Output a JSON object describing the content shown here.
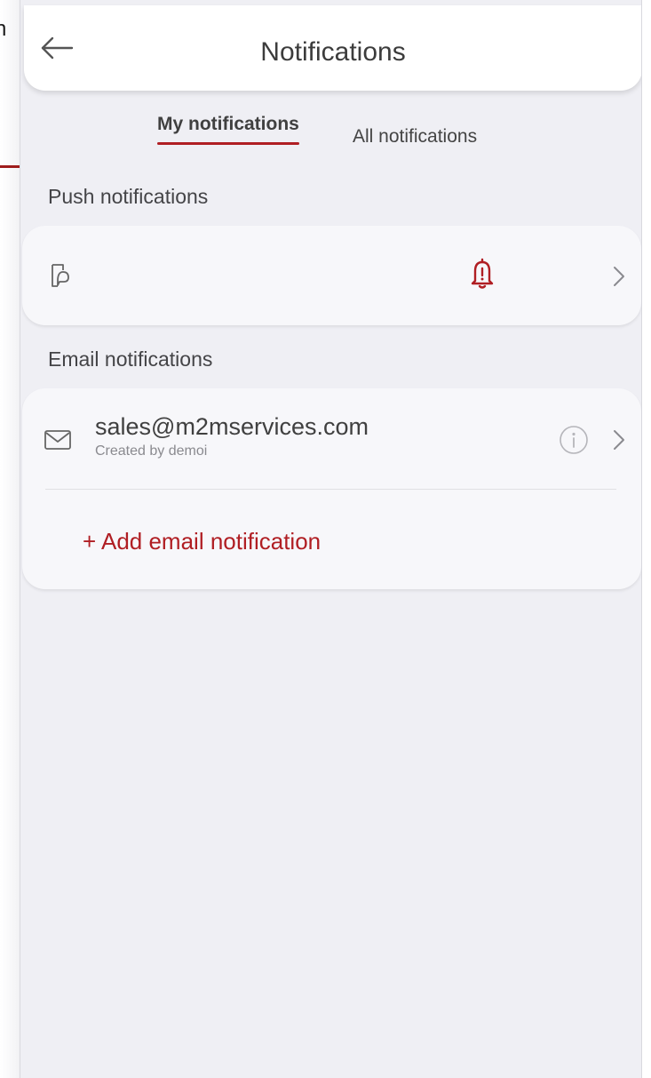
{
  "edge_text": "n",
  "header": {
    "title": "Notifications",
    "back_icon": "arrow-left-icon"
  },
  "tabs": [
    {
      "label": "My notifications",
      "active": true
    },
    {
      "label": "All notifications",
      "active": false
    }
  ],
  "push_section": {
    "title": "Push notifications",
    "device_icon": "mobile-device-icon",
    "status_icon": "bell-alert-icon",
    "chevron_icon": "chevron-right-icon"
  },
  "email_section": {
    "title": "Email notifications",
    "items": [
      {
        "address": "sales@m2mservices.com",
        "subtitle": "Created by demoi",
        "icon": "envelope-icon",
        "info_icon": "info-icon",
        "chevron_icon": "chevron-right-icon"
      }
    ],
    "add_label": "+ Add email notification"
  },
  "colors": {
    "accent": "#b01e23",
    "background": "#efeff4",
    "card": "#f7f7fa",
    "text": "#404040"
  }
}
